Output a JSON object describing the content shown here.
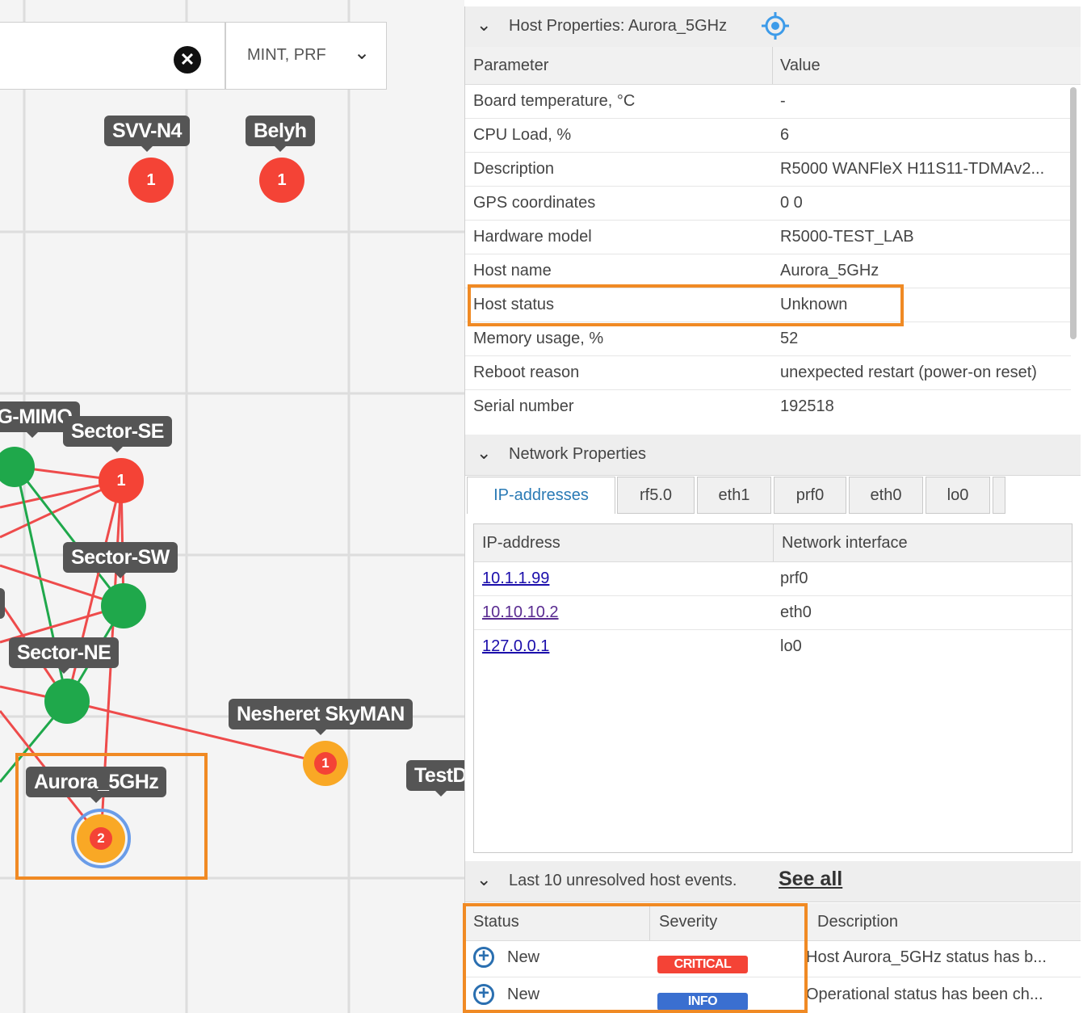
{
  "map": {
    "filter": {
      "value": "",
      "selected": "MINT, PRF"
    },
    "nodes": [
      {
        "label": "SVV-N4",
        "badge": "1"
      },
      {
        "label": "Belyh",
        "badge": "1"
      },
      {
        "label": "IG-MIMO"
      },
      {
        "label": "Sector-SE",
        "badge": "1"
      },
      {
        "label": "Sector-SW"
      },
      {
        "label": "Sector-NE"
      },
      {
        "label": "Nesheret SkyMAN",
        "badge": "1"
      },
      {
        "label": "Aurora_5GHz",
        "badge": "2"
      },
      {
        "label": "TestD"
      },
      {
        "label": "V"
      }
    ],
    "colors": {
      "critical": "#f44336",
      "warning": "#f9a825",
      "ok": "#1fa84b",
      "selected_ring": "#6a9ce8",
      "highlight": "#f08a24"
    }
  },
  "host_properties": {
    "title": "Host Properties: Aurora_5GHz",
    "columns": [
      "Parameter",
      "Value"
    ],
    "rows": [
      [
        "Board temperature, °C",
        "-"
      ],
      [
        "CPU Load, %",
        "6"
      ],
      [
        "Description",
        "R5000 WANFleX H11S11-TDMAv2..."
      ],
      [
        "GPS coordinates",
        "0 0"
      ],
      [
        "Hardware model",
        "R5000-TEST_LAB"
      ],
      [
        "Host name",
        "Aurora_5GHz"
      ],
      [
        "Host status",
        "Unknown"
      ],
      [
        "Memory usage, %",
        "52"
      ],
      [
        "Reboot reason",
        "unexpected restart (power-on reset)"
      ],
      [
        "Serial number",
        "192518"
      ]
    ]
  },
  "network_properties": {
    "title": "Network Properties",
    "tabs": [
      "IP-addresses",
      "rf5.0",
      "eth1",
      "prf0",
      "eth0",
      "lo0"
    ],
    "columns": [
      "IP-address",
      "Network interface"
    ],
    "rows": [
      [
        "10.1.1.99",
        "prf0"
      ],
      [
        "10.10.10.2",
        "eth0"
      ],
      [
        "127.0.0.1",
        "lo0"
      ]
    ]
  },
  "events": {
    "title": "Last 10 unresolved host events.",
    "see_all": "See all",
    "columns": [
      "Status",
      "Severity",
      "Description"
    ],
    "rows": [
      {
        "status": "New",
        "severity": "CRITICAL",
        "severity_color": "#f44336",
        "description": "Host Aurora_5GHz status has b..."
      },
      {
        "status": "New",
        "severity": "INFO",
        "severity_color": "#3a6fd0",
        "description": "Operational status has been ch..."
      }
    ]
  }
}
